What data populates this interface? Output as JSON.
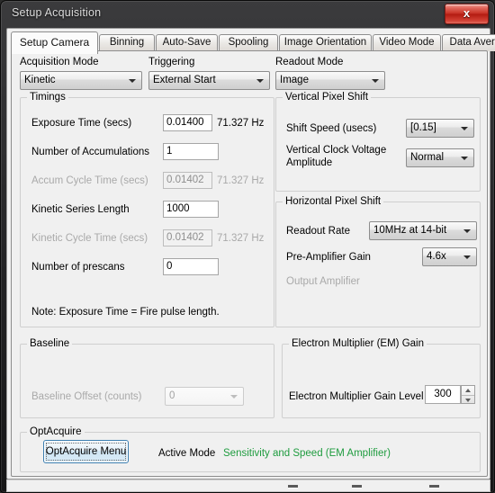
{
  "window": {
    "title": "Setup Acquisition",
    "close_label": "x"
  },
  "tabs": [
    {
      "label": "Setup Camera",
      "active": true
    },
    {
      "label": "Binning",
      "active": false
    },
    {
      "label": "Auto-Save",
      "active": false
    },
    {
      "label": "Spooling",
      "active": false
    },
    {
      "label": "Image Orientation",
      "active": false
    },
    {
      "label": "Video Mode",
      "active": false
    },
    {
      "label": "Data Averaging Filters",
      "active": false
    }
  ],
  "acquisition_mode": {
    "label": "Acquisition Mode",
    "value": "Kinetic"
  },
  "triggering": {
    "label": "Triggering",
    "value": "External Start"
  },
  "readout_mode": {
    "label": "Readout Mode",
    "value": "Image"
  },
  "timings": {
    "title": "Timings",
    "rows": [
      {
        "label": "Exposure Time (secs)",
        "value": "0.01400",
        "rate": "71.327 Hz",
        "enabled": true
      },
      {
        "label": "Number of Accumulations",
        "value": "1",
        "rate": "",
        "enabled": true
      },
      {
        "label": "Accum Cycle Time (secs)",
        "value": "0.01402",
        "rate": "71.327 Hz",
        "enabled": false
      },
      {
        "label": "Kinetic Series Length",
        "value": "1000",
        "rate": "",
        "enabled": true
      },
      {
        "label": "Kinetic Cycle Time (secs)",
        "value": "0.01402",
        "rate": "71.327 Hz",
        "enabled": false
      },
      {
        "label": "Number of prescans",
        "value": "0",
        "rate": "",
        "enabled": true
      }
    ],
    "note": "Note: Exposure Time = Fire pulse length."
  },
  "vertical_pixel_shift": {
    "title": "Vertical Pixel Shift",
    "shift_speed_label": "Shift Speed (usecs)",
    "shift_speed_value": "[0.15]",
    "clock_voltage_label_line1": "Vertical Clock Voltage",
    "clock_voltage_label_line2": "Amplitude",
    "clock_voltage_value": "Normal"
  },
  "horizontal_pixel_shift": {
    "title": "Horizontal Pixel Shift",
    "readout_rate_label": "Readout Rate",
    "readout_rate_value": "10MHz at 14-bit",
    "preamp_gain_label": "Pre-Amplifier Gain",
    "preamp_gain_value": "4.6x",
    "output_amplifier_label": "Output Amplifier"
  },
  "baseline": {
    "title": "Baseline",
    "offset_label": "Baseline Offset (counts)",
    "offset_value": "0"
  },
  "em_gain": {
    "title": "Electron Multiplier (EM) Gain",
    "level_label": "Electron Multiplier Gain Level",
    "level_value": "300"
  },
  "optacquire": {
    "title": "OptAcquire",
    "button_label": "OptAcquire Menu",
    "active_mode_label": "Active Mode",
    "active_mode_value": "Sensitivity and Speed (EM Amplifier)",
    "active_mode_color": "#1f9c3f"
  }
}
